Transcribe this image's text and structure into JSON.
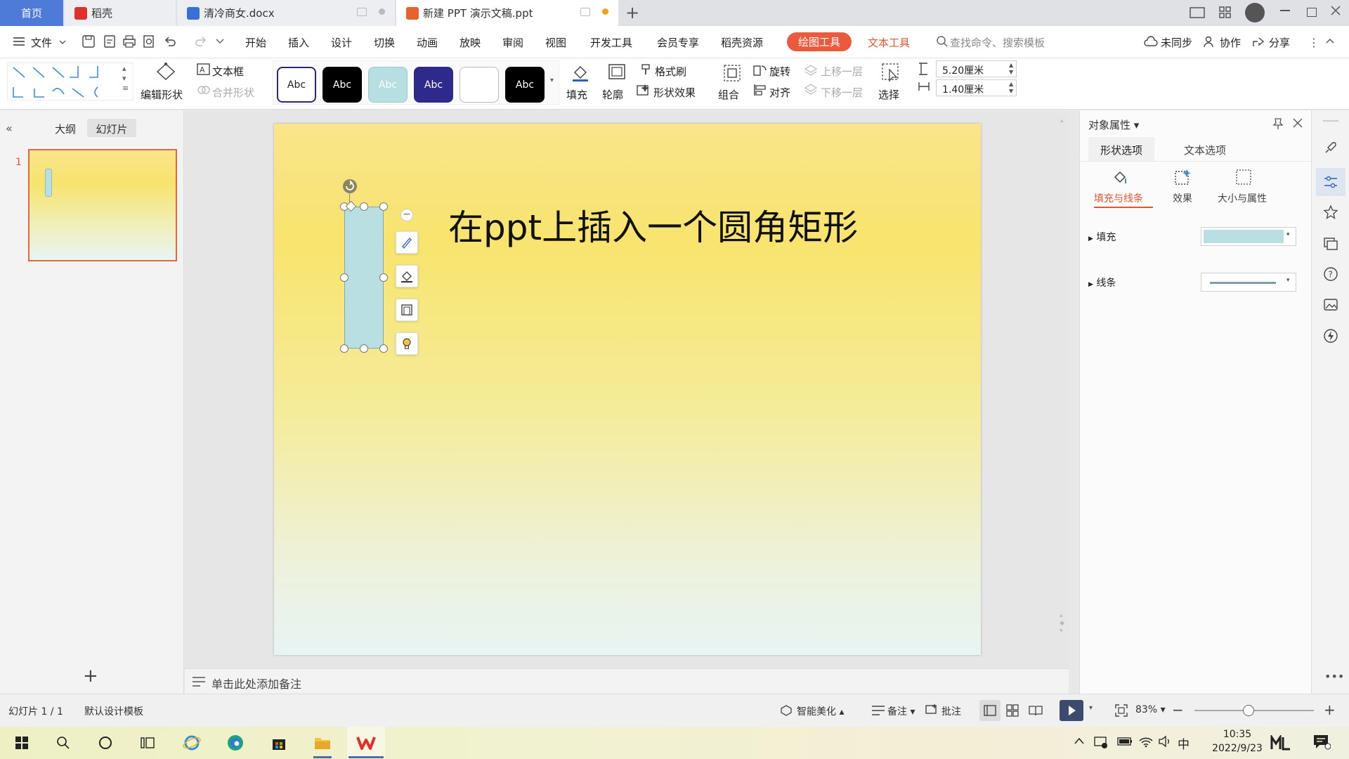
{
  "tabs": {
    "home": "首页",
    "daoke": "稻壳",
    "doc": "清冷商女.docx",
    "ppt": "新建 PPT 演示文稿.ppt",
    "new_tab": "+"
  },
  "menu": {
    "file": "文件",
    "items": [
      "开始",
      "插入",
      "设计",
      "切换",
      "动画",
      "放映",
      "审阅",
      "视图",
      "开发工具",
      "会员专享",
      "稻壳资源"
    ],
    "drawing_tools": "绘图工具",
    "text_tools": "文本工具",
    "search_placeholder": "查找命令、搜索模板",
    "sync": "未同步",
    "collab": "协作",
    "share": "分享"
  },
  "ribbon": {
    "edit_shape": "编辑形状",
    "text_box": "文本框",
    "merge_shape": "合并形状",
    "style_samples": [
      {
        "text": "Abc",
        "bg": "#ffffff",
        "fg": "#222222",
        "border": "#2a2a6a"
      },
      {
        "text": "Abc",
        "bg": "#000000",
        "fg": "#ffffff",
        "border": "#000000"
      },
      {
        "text": "Abc",
        "bg": "#b7dfe2",
        "fg": "#ffffff",
        "border": "#9cc9cc"
      },
      {
        "text": "Abc",
        "bg": "#2e2a8c",
        "fg": "#ffffff",
        "border": "#2e2a8c"
      },
      {
        "text": "",
        "bg": "#ffffff",
        "fg": "#222222",
        "border": "#bbbbbb"
      },
      {
        "text": "Abc",
        "bg": "#000000",
        "fg": "#ffffff",
        "border": "#000000"
      }
    ],
    "fill": "填充",
    "outline": "轮廓",
    "format_painter": "格式刷",
    "shape_effects": "形状效果",
    "group": "组合",
    "rotate": "旋转",
    "align": "对齐",
    "bring_forward": "上移一层",
    "send_backward": "下移一层",
    "select": "选择",
    "height": "5.20厘米",
    "width": "1.40厘米"
  },
  "left_panel": {
    "outline_tab": "大纲",
    "slides_tab": "幻灯片",
    "slide_number": "1",
    "add": "+"
  },
  "slide": {
    "title": "在ppt上插入一个圆角矩形",
    "shape_fill": "#b9dfe2"
  },
  "notes_placeholder": "单击此处添加备注",
  "right_panel": {
    "title": "对象属性",
    "tab_shape": "形状选项",
    "tab_text": "文本选项",
    "sub_fill_line": "填充与线条",
    "sub_effect": "效果",
    "sub_size": "大小与属性",
    "fill_label": "填充",
    "line_label": "线条",
    "fill_color": "#b9dfe2"
  },
  "status": {
    "slide_info": "幻灯片 1 / 1",
    "template": "默认设计模板",
    "beautify": "智能美化",
    "notes": "备注",
    "comments": "批注",
    "zoom": "83%",
    "zoom_level": 0.45
  },
  "taskbar": {
    "time": "10:35",
    "date": "2022/9/23",
    "ime": "中"
  }
}
